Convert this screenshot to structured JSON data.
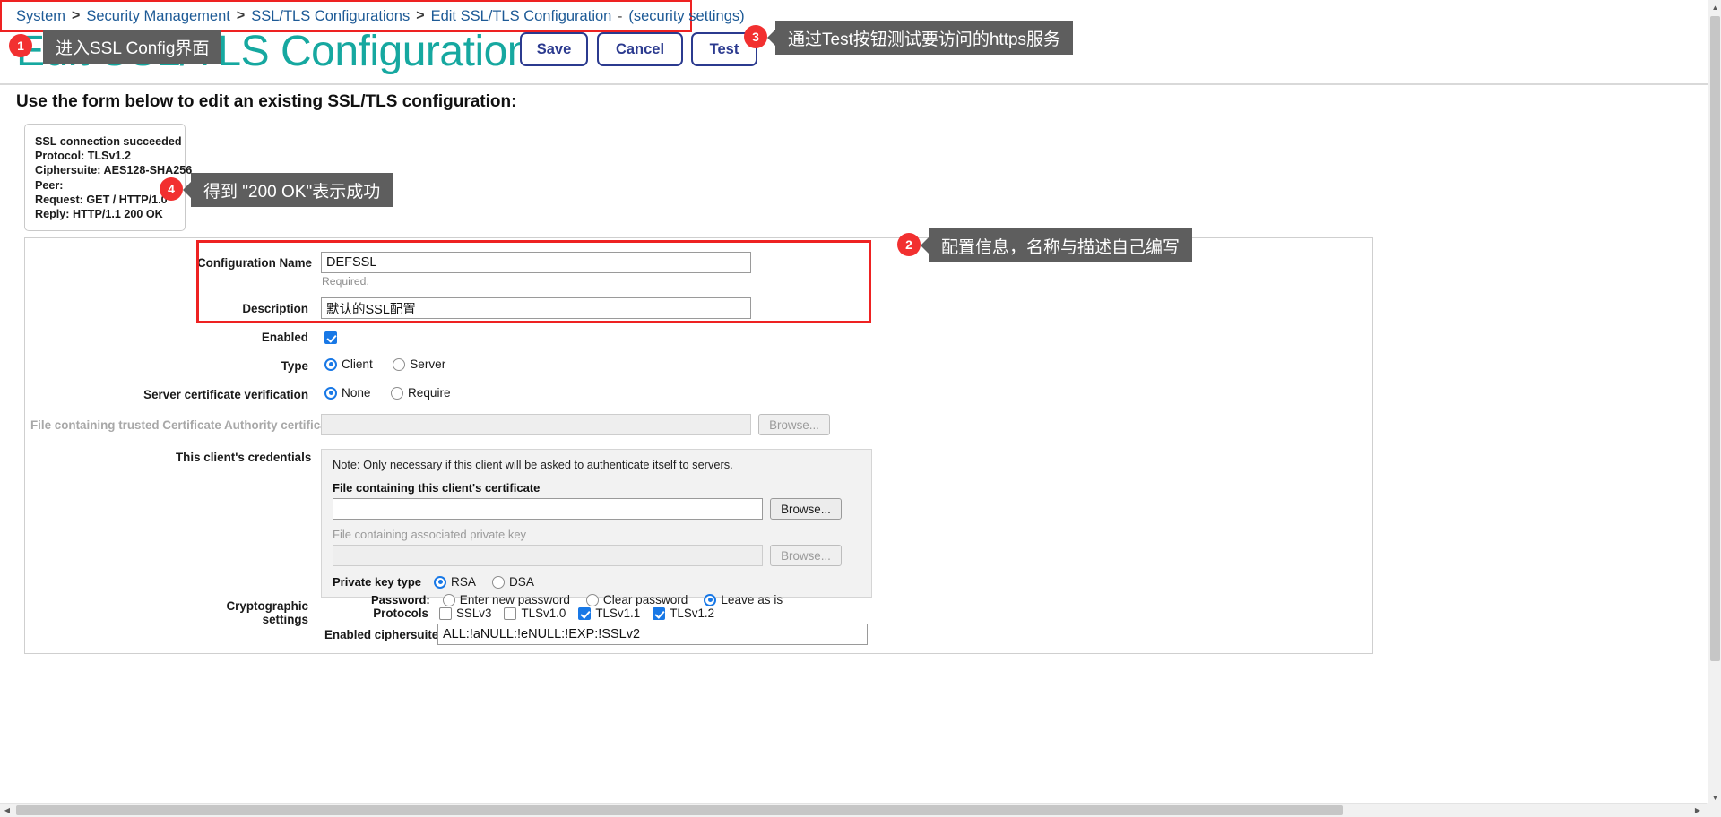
{
  "breadcrumb": {
    "items": [
      "System",
      "Security Management",
      "SSL/TLS Configurations",
      "Edit SSL/TLS Configuration"
    ],
    "separator": ">",
    "dash": "-",
    "suffix": "(security settings)"
  },
  "header": {
    "title": "Edit SSL/TLS Configuration",
    "save_label": "Save",
    "cancel_label": "Cancel",
    "test_label": "Test"
  },
  "intro": "Use the form below to edit an existing SSL/TLS configuration:",
  "ssl_result": {
    "lines": [
      "SSL connection succeeded",
      "Protocol: TLSv1.2",
      "Ciphersuite: AES128-SHA256",
      "Peer:",
      "Request: GET / HTTP/1.0",
      "Reply: HTTP/1.1 200 OK"
    ]
  },
  "form": {
    "configuration_name": {
      "label": "Configuration Name",
      "value": "DEFSSL",
      "note": "Required."
    },
    "description": {
      "label": "Description",
      "value": "默认的SSL配置"
    },
    "enabled": {
      "label": "Enabled",
      "checked": true
    },
    "type": {
      "label": "Type",
      "options": [
        "Client",
        "Server"
      ],
      "selected": "Client"
    },
    "server_cert_verification": {
      "label": "Server certificate verification",
      "options": [
        "None",
        "Require"
      ],
      "selected": "None"
    },
    "trusted_ca_file": {
      "label": "File containing trusted Certificate Authority certificate(s)",
      "value": "",
      "browse_label": "Browse..."
    },
    "client_credentials": {
      "label": "This client's credentials",
      "note": "Note: Only necessary if this client will be asked to authenticate itself to servers.",
      "cert_label": "File containing this client's certificate",
      "cert_value": "",
      "cert_browse_label": "Browse...",
      "key_label": "File containing associated private key",
      "key_value": "",
      "key_browse_label": "Browse...",
      "private_key_type_label": "Private key type",
      "private_key_type_options": [
        "RSA",
        "DSA"
      ],
      "private_key_type_selected": "RSA",
      "password_label": "Password:",
      "password_options": [
        "Enter new password",
        "Clear password",
        "Leave as is"
      ],
      "password_selected": "Leave as is"
    },
    "cryptographic_settings": {
      "label": "Cryptographic settings",
      "protocols_label": "Protocols",
      "protocols": [
        {
          "name": "SSLv3",
          "checked": false
        },
        {
          "name": "TLSv1.0",
          "checked": false
        },
        {
          "name": "TLSv1.1",
          "checked": true
        },
        {
          "name": "TLSv1.2",
          "checked": true
        }
      ],
      "ciphersuites_label": "Enabled ciphersuites",
      "ciphersuites_value": "ALL:!aNULL:!eNULL:!EXP:!SSLv2"
    }
  },
  "annotations": [
    {
      "num": "1",
      "text": "进入SSL Config界面"
    },
    {
      "num": "2",
      "text": "配置信息，名称与描述自己编写"
    },
    {
      "num": "3",
      "text": "通过Test按钮测试要访问的https服务"
    },
    {
      "num": "4",
      "text": "得到 \"200 OK\"表示成功"
    }
  ],
  "colors": {
    "title": "#16a8a0",
    "link": "#1d5a96",
    "button_border": "#2b3a8f",
    "highlight": "#ee2222",
    "badge": "#f23030",
    "callout_bg": "#5e5e5e",
    "accent_blue": "#1878e6"
  },
  "icons": {
    "scroll_up": "▲",
    "scroll_down": "▼",
    "scroll_left": "◀",
    "scroll_right": "▶"
  }
}
